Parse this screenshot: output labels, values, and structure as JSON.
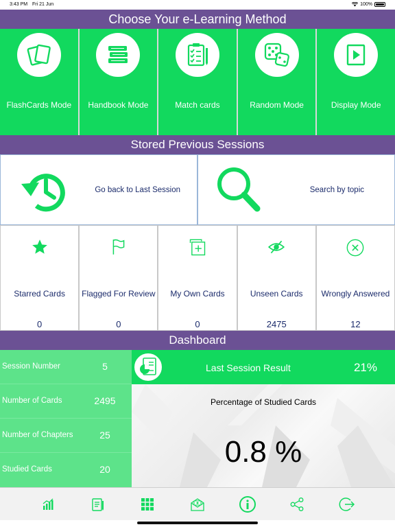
{
  "status_bar": {
    "time": "3:43 PM",
    "date": "Fri 21 Jun",
    "battery": "100%"
  },
  "methods": {
    "title": "Choose Your e-Learning Method",
    "items": [
      {
        "label": "FlashCards Mode",
        "icon": "flashcards-icon"
      },
      {
        "label": "Handbook Mode",
        "icon": "books-icon"
      },
      {
        "label": "Match cards",
        "icon": "checklist-icon"
      },
      {
        "label": "Random Mode",
        "icon": "dice-icon"
      },
      {
        "label": "Display Mode",
        "icon": "play-icon"
      }
    ]
  },
  "sessions": {
    "title": "Stored Previous Sessions",
    "last_session_label": "Go back to Last Session",
    "search_topic_label": "Search by topic"
  },
  "categories": [
    {
      "label": "Starred Cards",
      "count": "0",
      "icon": "star-icon"
    },
    {
      "label": "Flagged For Review",
      "count": "0",
      "icon": "flag-icon"
    },
    {
      "label": "My Own Cards",
      "count": "0",
      "icon": "add-card-icon"
    },
    {
      "label": "Unseen Cards",
      "count": "2475",
      "icon": "eye-off-icon"
    },
    {
      "label": "Wrongly Answered",
      "count": "12",
      "icon": "x-circle-icon"
    }
  ],
  "dashboard": {
    "title": "Dashboard",
    "stats": [
      {
        "label": "Session Number",
        "value": "5"
      },
      {
        "label": "Number of Cards",
        "value": "2495"
      },
      {
        "label": "Number of Chapters",
        "value": "25"
      },
      {
        "label": "Studied Cards",
        "value": "20"
      }
    ],
    "last_result_label": "Last Session Result",
    "last_result_value": "21%",
    "studied_pct_title": "Percentage of Studied Cards",
    "studied_pct_value": "0.8 %"
  },
  "tabbar": [
    "chart-icon",
    "notes-icon",
    "grid-icon",
    "mail-icon",
    "info-icon",
    "share-icon",
    "logout-icon"
  ],
  "colors": {
    "green": "#12d95e",
    "light_green": "#5de38a",
    "purple": "#6b5194",
    "navy": "#1b2b6b"
  }
}
